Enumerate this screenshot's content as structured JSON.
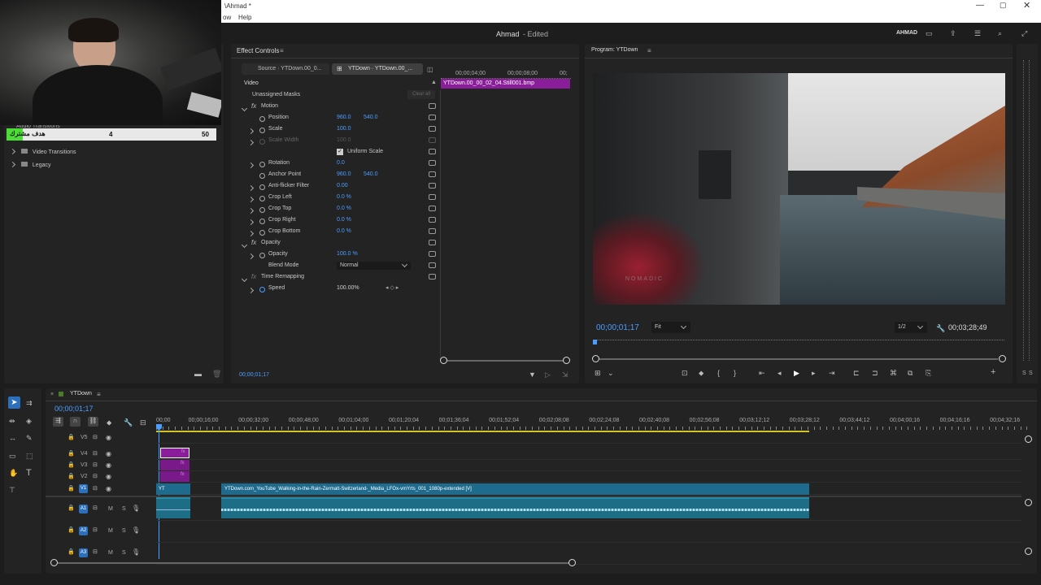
{
  "titlebar": {
    "title": "\\Ahmad *"
  },
  "menubar": {
    "items": [
      "ow",
      "Help"
    ]
  },
  "appbar": {
    "project": "Ahmad",
    "status": "- Edited",
    "user": "AHMAD"
  },
  "project_panel": {
    "overlay_label": "هدف مشترك",
    "overlay_count": "4",
    "overlay_goal": "50",
    "items": [
      "Audio Transitions",
      "Video Transitions",
      "Legacy"
    ]
  },
  "effect_controls": {
    "title": "Effect Controls",
    "source_tab": "Source · YTDown.00_0...",
    "seq_tab": "YTDown · YTDown.00_...",
    "timecodes": [
      "00;00;04;00",
      "00;00;08;00",
      "00;"
    ],
    "clip_name": "YTDown.00_00_02_04.Still001.bmp",
    "section": "Video",
    "masks": "Unassigned Masks",
    "clear_all": "Clear all",
    "current_time": "00;00;01;17",
    "rows": [
      {
        "label": "Motion",
        "fx": true,
        "level": 0,
        "expanded": true
      },
      {
        "label": "Position",
        "level": 1,
        "stopwatch": true,
        "v1": "960.0",
        "v2": "540.0"
      },
      {
        "label": "Scale",
        "level": 1,
        "stopwatch": true,
        "expand": true,
        "v1": "100.0"
      },
      {
        "label": "Scale Width",
        "level": 1,
        "stopwatch": true,
        "expand": true,
        "v1": "100.0",
        "disabled": true
      },
      {
        "label": "",
        "level": 1,
        "checkbox": "Uniform Scale"
      },
      {
        "label": "Rotation",
        "level": 1,
        "stopwatch": true,
        "expand": true,
        "v1": "0.0"
      },
      {
        "label": "Anchor Point",
        "level": 1,
        "stopwatch": true,
        "v1": "960.0",
        "v2": "540.0"
      },
      {
        "label": "Anti-flicker Filter",
        "level": 1,
        "stopwatch": true,
        "expand": true,
        "v1": "0.00"
      },
      {
        "label": "Crop Left",
        "level": 1,
        "stopwatch": true,
        "expand": true,
        "v1": "0.0 %"
      },
      {
        "label": "Crop Top",
        "level": 1,
        "stopwatch": true,
        "expand": true,
        "v1": "0.0 %"
      },
      {
        "label": "Crop Right",
        "level": 1,
        "stopwatch": true,
        "expand": true,
        "v1": "0.0 %"
      },
      {
        "label": "Crop Bottom",
        "level": 1,
        "stopwatch": true,
        "expand": true,
        "v1": "0.0 %"
      },
      {
        "label": "Opacity",
        "fx": true,
        "level": 0,
        "expanded": true
      },
      {
        "label": "Opacity",
        "level": 1,
        "stopwatch": true,
        "expand": true,
        "v1": "100.0 %"
      },
      {
        "label": "Blend Mode",
        "level": 1,
        "select": "Normal"
      },
      {
        "label": "Time Remapping",
        "fx": true,
        "level": 0,
        "expanded": true,
        "disabledfx": true
      },
      {
        "label": "Speed",
        "level": 1,
        "stopwatch": true,
        "expand": true,
        "v1": "100.00%",
        "keyframes": true,
        "noreset": true
      }
    ]
  },
  "program": {
    "title": "Program: YTDown",
    "timecode": "00;00;01;17",
    "fit": "Fit",
    "quality": "1/2",
    "duration": "00;03;28;49",
    "watermark": "NOMADIC"
  },
  "timeline": {
    "seq_name": "YTDown",
    "timecode": "00;00;01;17",
    "ruler": [
      "00;00",
      "00;00;16;00",
      "00;00;32;00",
      "00;00;48;00",
      "00;01;04;00",
      "00;01;20;04",
      "00;01;36;04",
      "00;01;52;04",
      "00;02;08;08",
      "00;02;24;08",
      "00;02;40;08",
      "00;02;56;08",
      "00;03;12;12",
      "00;03;28;12",
      "00;03;44;12",
      "00;04;00;16",
      "00;04;16;16",
      "00;04;32;16"
    ],
    "video_tracks": [
      "V5",
      "V4",
      "V3",
      "V2",
      "V1"
    ],
    "audio_tracks": [
      "A1",
      "A2",
      "A3"
    ],
    "clip_short": "YT",
    "clip_main": "YTDown.com_YouTube_Walking-in-the-Rain-Zermatt-Switzerland-_Media_LFOx-vmYrts_001_1080p-extended [V]",
    "fx_label": "fx",
    "m": "M",
    "s": "S"
  },
  "colors": {
    "accent": "#2b6fbd",
    "clip_video": "#1f6b8e",
    "clip_pink": "#8a1d9a",
    "timecode": "#4a9eff"
  }
}
